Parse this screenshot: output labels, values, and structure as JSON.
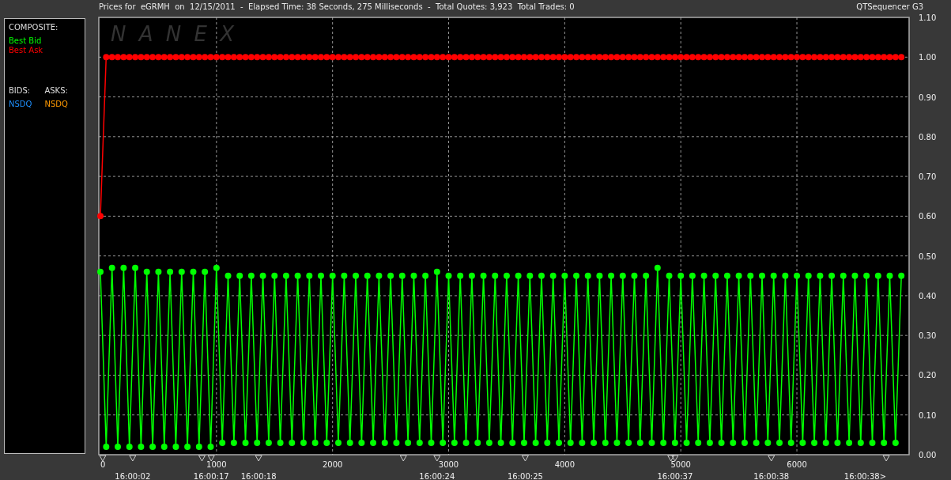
{
  "header": {
    "title": "Prices for  eGRMH  on  12/15/2011  -  Elapsed Time: 38 Seconds, 275 Milliseconds  -  Total Quotes: 3,923  Total Trades: 0",
    "app_name": "QTSequencer G3"
  },
  "legend": {
    "composite_heading": "COMPOSITE:",
    "bids_heading": "BIDS:",
    "asks_heading": "ASKS:",
    "bids": [
      {
        "label": "NSDQ",
        "color": "#1e90ff"
      }
    ],
    "asks": [
      {
        "label": "NSDQ",
        "color": "#ff9900"
      }
    ]
  },
  "chart": {
    "logo": "N A N E X",
    "chart_data": {
      "type": "line",
      "xlim": [
        0,
        6960
      ],
      "ylim": [
        0,
        1.1
      ],
      "xticks": [
        0,
        1000,
        2000,
        3000,
        4000,
        5000,
        6000
      ],
      "yticks": [
        {
          "value": 0,
          "label": "0.00"
        },
        {
          "value": 0.1,
          "label": "0.10"
        },
        {
          "value": 0.2,
          "label": "0.20"
        },
        {
          "value": 0.3,
          "label": "0.30"
        },
        {
          "value": 0.4,
          "label": "0.40"
        },
        {
          "value": 0.5,
          "label": "0.50"
        },
        {
          "value": 0.6,
          "label": "0.60"
        },
        {
          "value": 0.7,
          "label": "0.70"
        },
        {
          "value": 0.8,
          "label": "0.80"
        },
        {
          "value": 0.9,
          "label": "0.90"
        },
        {
          "value": 1.0,
          "label": "1.00"
        },
        {
          "value": 1.1,
          "label": "1.10"
        }
      ],
      "x": [
        0,
        50,
        100,
        150,
        200,
        250,
        300,
        350,
        400,
        450,
        500,
        550,
        600,
        650,
        700,
        750,
        800,
        850,
        900,
        950,
        1000,
        1050,
        1100,
        1150,
        1200,
        1250,
        1300,
        1350,
        1400,
        1450,
        1500,
        1550,
        1600,
        1650,
        1700,
        1750,
        1800,
        1850,
        1900,
        1950,
        2000,
        2050,
        2100,
        2150,
        2200,
        2250,
        2300,
        2350,
        2400,
        2450,
        2500,
        2550,
        2600,
        2650,
        2700,
        2750,
        2800,
        2850,
        2900,
        2950,
        3000,
        3050,
        3100,
        3150,
        3200,
        3250,
        3300,
        3350,
        3400,
        3450,
        3500,
        3550,
        3600,
        3650,
        3700,
        3750,
        3800,
        3850,
        3900,
        3950,
        4000,
        4050,
        4100,
        4150,
        4200,
        4250,
        4300,
        4350,
        4400,
        4450,
        4500,
        4550,
        4600,
        4650,
        4700,
        4750,
        4800,
        4850,
        4900,
        4950,
        5000,
        5050,
        5100,
        5150,
        5200,
        5250,
        5300,
        5350,
        5400,
        5450,
        5500,
        5550,
        5600,
        5650,
        5700,
        5750,
        5800,
        5850,
        5900,
        5950,
        6000,
        6050,
        6100,
        6150,
        6200,
        6250,
        6300,
        6350,
        6400,
        6450,
        6500,
        6550,
        6600,
        6650,
        6700,
        6750,
        6800,
        6850,
        6900
      ],
      "series": [
        {
          "name": "Best Bid",
          "color": "#00ff00",
          "marker": "circle",
          "values": [
            0.46,
            0.02,
            0.47,
            0.02,
            0.47,
            0.02,
            0.47,
            0.02,
            0.46,
            0.02,
            0.46,
            0.02,
            0.46,
            0.02,
            0.46,
            0.02,
            0.46,
            0.02,
            0.46,
            0.02,
            0.47,
            0.03,
            0.45,
            0.03,
            0.45,
            0.03,
            0.45,
            0.03,
            0.45,
            0.03,
            0.45,
            0.03,
            0.45,
            0.03,
            0.45,
            0.03,
            0.45,
            0.03,
            0.45,
            0.03,
            0.45,
            0.03,
            0.45,
            0.03,
            0.45,
            0.03,
            0.45,
            0.03,
            0.45,
            0.03,
            0.45,
            0.03,
            0.45,
            0.03,
            0.45,
            0.03,
            0.45,
            0.03,
            0.46,
            0.03,
            0.45,
            0.03,
            0.45,
            0.03,
            0.45,
            0.03,
            0.45,
            0.03,
            0.45,
            0.03,
            0.45,
            0.03,
            0.45,
            0.03,
            0.45,
            0.03,
            0.45,
            0.03,
            0.45,
            0.03,
            0.45,
            0.03,
            0.45,
            0.03,
            0.45,
            0.03,
            0.45,
            0.03,
            0.45,
            0.03,
            0.45,
            0.03,
            0.45,
            0.03,
            0.45,
            0.03,
            0.47,
            0.03,
            0.45,
            0.03,
            0.45,
            0.03,
            0.45,
            0.03,
            0.45,
            0.03,
            0.45,
            0.03,
            0.45,
            0.03,
            0.45,
            0.03,
            0.45,
            0.03,
            0.45,
            0.03,
            0.45,
            0.03,
            0.45,
            0.03,
            0.45,
            0.03,
            0.45,
            0.03,
            0.45,
            0.03,
            0.45,
            0.03,
            0.45,
            0.03,
            0.45,
            0.03,
            0.45,
            0.03,
            0.45,
            0.03,
            0.45,
            0.03,
            0.45
          ]
        },
        {
          "name": "Best Ask",
          "color": "#ff0000",
          "marker": "circle",
          "values": [
            0.6,
            1.0,
            1.0,
            1.0,
            1.0,
            1.0,
            1.0,
            1.0,
            1.0,
            1.0,
            1.0,
            1.0,
            1.0,
            1.0,
            1.0,
            1.0,
            1.0,
            1.0,
            1.0,
            1.0,
            1.0,
            1.0,
            1.0,
            1.0,
            1.0,
            1.0,
            1.0,
            1.0,
            1.0,
            1.0,
            1.0,
            1.0,
            1.0,
            1.0,
            1.0,
            1.0,
            1.0,
            1.0,
            1.0,
            1.0,
            1.0,
            1.0,
            1.0,
            1.0,
            1.0,
            1.0,
            1.0,
            1.0,
            1.0,
            1.0,
            1.0,
            1.0,
            1.0,
            1.0,
            1.0,
            1.0,
            1.0,
            1.0,
            1.0,
            1.0,
            1.0,
            1.0,
            1.0,
            1.0,
            1.0,
            1.0,
            1.0,
            1.0,
            1.0,
            1.0,
            1.0,
            1.0,
            1.0,
            1.0,
            1.0,
            1.0,
            1.0,
            1.0,
            1.0,
            1.0,
            1.0,
            1.0,
            1.0,
            1.0,
            1.0,
            1.0,
            1.0,
            1.0,
            1.0,
            1.0,
            1.0,
            1.0,
            1.0,
            1.0,
            1.0,
            1.0,
            1.0,
            1.0,
            1.0,
            1.0,
            1.0,
            1.0,
            1.0,
            1.0,
            1.0,
            1.0,
            1.0,
            1.0,
            1.0,
            1.0,
            1.0,
            1.0,
            1.0,
            1.0,
            1.0,
            1.0,
            1.0,
            1.0,
            1.0,
            1.0,
            1.0,
            1.0,
            1.0,
            1.0,
            1.0,
            1.0,
            1.0,
            1.0,
            1.0,
            1.0,
            1.0,
            1.0,
            1.0,
            1.0,
            1.0,
            1.0,
            1.0,
            1.0,
            1.0
          ]
        }
      ],
      "grid": true
    },
    "time_labels": [
      "16:00:02",
      "16:00:17",
      "16:00:18",
      "16:00:24",
      "16:00:25",
      "16:00:37",
      "16:00:38",
      "16:00:38>"
    ]
  }
}
